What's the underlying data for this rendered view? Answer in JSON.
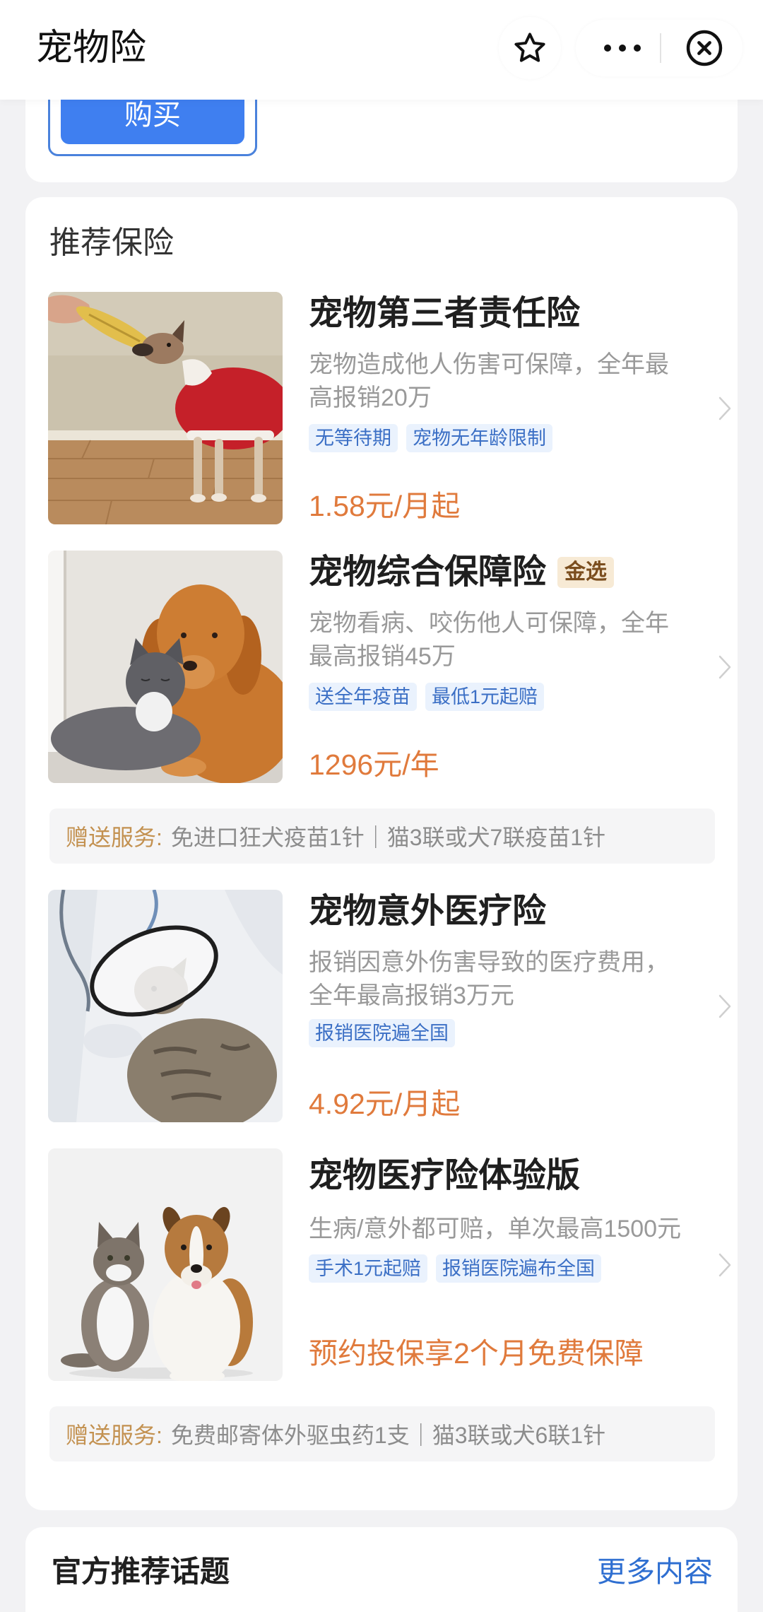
{
  "header": {
    "title": "宠物险",
    "icons": {
      "favorite": "star-icon",
      "more": "more-dots-icon",
      "close": "close-circle-icon"
    }
  },
  "top_card": {
    "buy_button_label": "购买"
  },
  "recommend": {
    "heading": "推荐保险",
    "chevron_icon": "chevron-right-icon",
    "products": [
      {
        "title": "宠物第三者责任险",
        "desc_lines": [
          "宠物造成他人伤害可保障，全年最",
          "高报销20万"
        ],
        "tags": [
          "无等待期",
          "宠物无年龄限制"
        ],
        "price": "1.58元/月起"
      },
      {
        "title": "宠物综合保障险",
        "badge": "金选",
        "desc_lines": [
          "宠物看病、咬伤他人可保障，全年",
          "最高报销45万"
        ],
        "tags": [
          "送全年疫苗",
          "最低1元起赔"
        ],
        "price": "1296元/年",
        "gift": {
          "label": "赠送服务:",
          "text": "免进口狂犬疫苗1针｜猫3联或犬7联疫苗1针"
        }
      },
      {
        "title": "宠物意外医疗险",
        "desc_lines": [
          "报销因意外伤害导致的医疗费用，",
          "全年最高报销3万元"
        ],
        "tags": [
          "报销医院遍全国"
        ],
        "price": "4.92元/月起"
      },
      {
        "title": "宠物医疗险体验版",
        "desc_lines": [
          "生病/意外都可赔，单次最高1500元"
        ],
        "tags": [
          "手术1元起赔",
          "报销医院遍布全国"
        ],
        "price": "预约投保享2个月免费保障",
        "gift": {
          "label": "赠送服务:",
          "text": "免费邮寄体外驱虫药1支｜猫3联或犬6联1针"
        }
      }
    ]
  },
  "topics": {
    "heading": "官方推荐话题",
    "more_label": "更多内容"
  },
  "colors": {
    "primary_blue": "#3f7ff0",
    "link_blue": "#2f6fd1",
    "price_orange": "#e07a3c",
    "tag_bg": "#eaf2fd",
    "tag_text": "#3b6fc5",
    "badge_bg": "#f7ead5",
    "badge_text": "#7b4e1e",
    "gift_label": "#c39150",
    "page_bg": "#f2f2f4"
  }
}
